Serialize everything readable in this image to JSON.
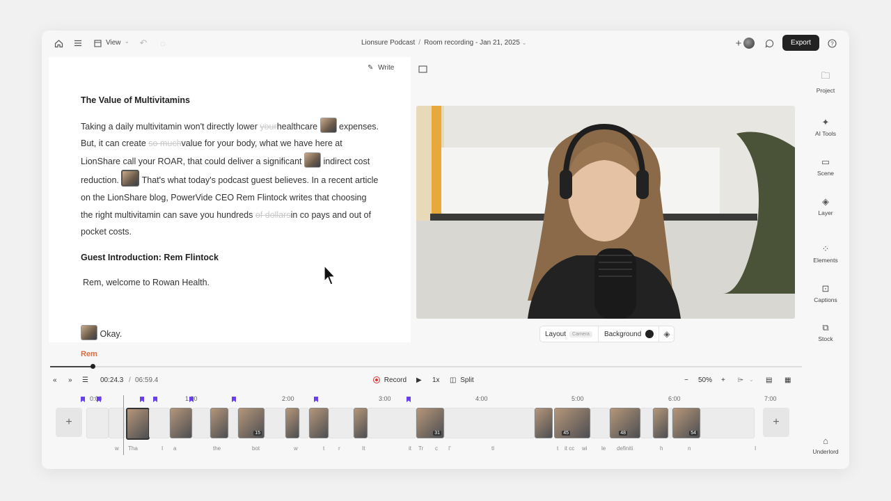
{
  "topbar": {
    "view_label": "View",
    "project_name": "Lionsure Podcast",
    "separator": "/",
    "recording_name": "Room recording - Jan 21, 2025",
    "export_label": "Export",
    "icons": [
      "home-icon",
      "menu-icon",
      "view-icon",
      "undo-icon",
      "redo-icon",
      "add-collaborator-icon",
      "comment-icon",
      "help-icon"
    ]
  },
  "editor": {
    "write_label": "Write",
    "heading1": "The Value of Multivitamins",
    "p1": {
      "t1": "Taking a daily multivitamin won't directly lower",
      "s1": "your",
      "t2": "healthcare",
      "t3": "expenses. But, it can create",
      "s2": "so much",
      "t4": "value for your body, what we have here at LionShare call your ROAR, that could deliver a significant",
      "t5": "indirect cost reduction.",
      "t6": "That's what today's podcast guest believes. In a recent article on the LionShare blog, PowerVide CEO Rem Flintock writes that choosing the right multivitamin can save you hundreds",
      "s3": "of dollars",
      "t7": "in co pays and out of pocket costs."
    },
    "heading2": "Guest Introduction: Rem Flintock",
    "p2": "Rem, welcome to Rowan Health.",
    "p3": "Okay.",
    "speaker": "Rem"
  },
  "preview": {
    "layout_label": "Layout",
    "layout_value": "Camera",
    "background_label": "Background",
    "background_color": "#222222"
  },
  "sidebar": {
    "items": [
      {
        "label": "Project",
        "icon": "folder-icon"
      },
      {
        "label": "AI Tools",
        "icon": "sparkle-icon"
      },
      {
        "label": "Scene",
        "icon": "scene-icon"
      },
      {
        "label": "Layer",
        "icon": "layers-icon"
      },
      {
        "label": "Elements",
        "icon": "elements-icon"
      },
      {
        "label": "Captions",
        "icon": "captions-icon"
      },
      {
        "label": "Stock",
        "icon": "stock-icon"
      }
    ],
    "bottom_label": "Underlord"
  },
  "timeline": {
    "current_time": "00:24.3",
    "time_separator": "/",
    "total_time": "06:59.4",
    "record_label": "Record",
    "speed_label": "1x",
    "split_label": "Split",
    "zoom_label": "50%",
    "ruler": [
      "0:00",
      "1:00",
      "2:00",
      "3:00",
      "4:00",
      "5:00",
      "6:00",
      "7:00"
    ],
    "clip_numbers": [
      "15",
      "31",
      "45",
      "48",
      "54"
    ],
    "words": [
      "w",
      "Tha",
      "I",
      "a",
      "the",
      "bot",
      "w",
      "t",
      "r",
      "It",
      "it",
      "Tr",
      "c",
      "I'",
      "tl",
      "t",
      "it cc",
      "wi",
      "le",
      "definiti",
      "h",
      "n",
      "I"
    ],
    "accent_color": "#6a3ff0"
  }
}
